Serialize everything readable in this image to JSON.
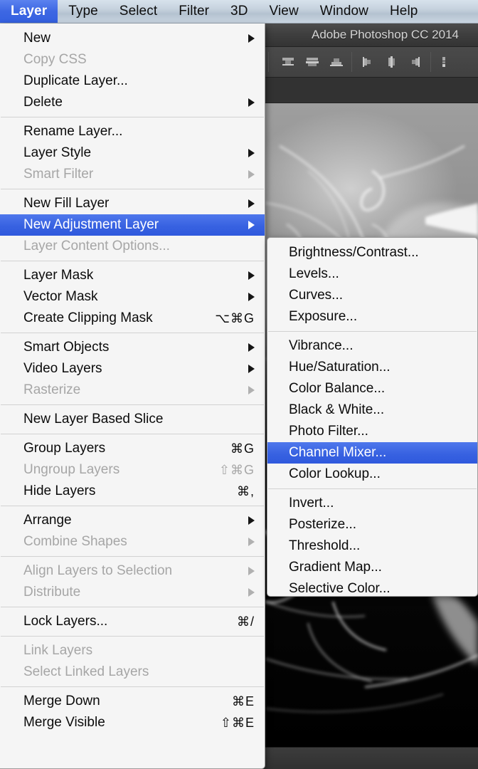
{
  "menubar": {
    "items": [
      {
        "label": "Layer",
        "active": true
      },
      {
        "label": "Type",
        "active": false
      },
      {
        "label": "Select",
        "active": false
      },
      {
        "label": "Filter",
        "active": false
      },
      {
        "label": "3D",
        "active": false
      },
      {
        "label": "View",
        "active": false
      },
      {
        "label": "Window",
        "active": false
      },
      {
        "label": "Help",
        "active": false
      }
    ]
  },
  "application": {
    "title": "Adobe Photoshop CC 2014",
    "align_icons": [
      "align-top-edges-icon",
      "align-vertical-centers-icon",
      "align-bottom-edges-icon",
      "align-left-edges-icon",
      "align-horizontal-centers-icon",
      "align-right-edges-icon",
      "distribute-top-edges-icon"
    ]
  },
  "colors": {
    "accent": "#3862e1",
    "menu_background": "#f5f5f5",
    "menu_text": "#0b0b0b",
    "menu_text_disabled": "#a6a6a6",
    "menubar_text": "#0d0d0d",
    "titlebar_text": "#d6d6d6"
  },
  "layer_menu": {
    "groups": [
      {
        "items": [
          {
            "label": "New",
            "accel": "",
            "arrow": true,
            "disabled": false,
            "selected": false
          },
          {
            "label": "Copy CSS",
            "accel": "",
            "arrow": false,
            "disabled": true,
            "selected": false
          },
          {
            "label": "Duplicate Layer...",
            "accel": "",
            "arrow": false,
            "disabled": false,
            "selected": false
          },
          {
            "label": "Delete",
            "accel": "",
            "arrow": true,
            "disabled": false,
            "selected": false
          }
        ]
      },
      {
        "items": [
          {
            "label": "Rename Layer...",
            "accel": "",
            "arrow": false,
            "disabled": false,
            "selected": false
          },
          {
            "label": "Layer Style",
            "accel": "",
            "arrow": true,
            "disabled": false,
            "selected": false
          },
          {
            "label": "Smart Filter",
            "accel": "",
            "arrow": true,
            "disabled": true,
            "selected": false
          }
        ]
      },
      {
        "items": [
          {
            "label": "New Fill Layer",
            "accel": "",
            "arrow": true,
            "disabled": false,
            "selected": false
          },
          {
            "label": "New Adjustment Layer",
            "accel": "",
            "arrow": true,
            "disabled": false,
            "selected": true
          },
          {
            "label": "Layer Content Options...",
            "accel": "",
            "arrow": false,
            "disabled": true,
            "selected": false
          }
        ]
      },
      {
        "items": [
          {
            "label": "Layer Mask",
            "accel": "",
            "arrow": true,
            "disabled": false,
            "selected": false
          },
          {
            "label": "Vector Mask",
            "accel": "",
            "arrow": true,
            "disabled": false,
            "selected": false
          },
          {
            "label": "Create Clipping Mask",
            "accel": "⌥⌘G",
            "arrow": false,
            "disabled": false,
            "selected": false
          }
        ]
      },
      {
        "items": [
          {
            "label": "Smart Objects",
            "accel": "",
            "arrow": true,
            "disabled": false,
            "selected": false
          },
          {
            "label": "Video Layers",
            "accel": "",
            "arrow": true,
            "disabled": false,
            "selected": false
          },
          {
            "label": "Rasterize",
            "accel": "",
            "arrow": true,
            "disabled": true,
            "selected": false
          }
        ]
      },
      {
        "items": [
          {
            "label": "New Layer Based Slice",
            "accel": "",
            "arrow": false,
            "disabled": false,
            "selected": false
          }
        ]
      },
      {
        "items": [
          {
            "label": "Group Layers",
            "accel": "⌘G",
            "arrow": false,
            "disabled": false,
            "selected": false
          },
          {
            "label": "Ungroup Layers",
            "accel": "⇧⌘G",
            "arrow": false,
            "disabled": true,
            "selected": false
          },
          {
            "label": "Hide Layers",
            "accel": "⌘,",
            "arrow": false,
            "disabled": false,
            "selected": false
          }
        ]
      },
      {
        "items": [
          {
            "label": "Arrange",
            "accel": "",
            "arrow": true,
            "disabled": false,
            "selected": false
          },
          {
            "label": "Combine Shapes",
            "accel": "",
            "arrow": true,
            "disabled": true,
            "selected": false
          }
        ]
      },
      {
        "items": [
          {
            "label": "Align Layers to Selection",
            "accel": "",
            "arrow": true,
            "disabled": true,
            "selected": false
          },
          {
            "label": "Distribute",
            "accel": "",
            "arrow": true,
            "disabled": true,
            "selected": false
          }
        ]
      },
      {
        "items": [
          {
            "label": "Lock Layers...",
            "accel": "⌘/",
            "arrow": false,
            "disabled": false,
            "selected": false
          }
        ]
      },
      {
        "items": [
          {
            "label": "Link Layers",
            "accel": "",
            "arrow": false,
            "disabled": true,
            "selected": false
          },
          {
            "label": "Select Linked Layers",
            "accel": "",
            "arrow": false,
            "disabled": true,
            "selected": false
          }
        ]
      },
      {
        "items": [
          {
            "label": "Merge Down",
            "accel": "⌘E",
            "arrow": false,
            "disabled": false,
            "selected": false
          },
          {
            "label": "Merge Visible",
            "accel": "⇧⌘E",
            "arrow": false,
            "disabled": false,
            "selected": false
          }
        ]
      }
    ]
  },
  "adjustment_submenu": {
    "groups": [
      {
        "items": [
          {
            "label": "Brightness/Contrast...",
            "selected": false
          },
          {
            "label": "Levels...",
            "selected": false
          },
          {
            "label": "Curves...",
            "selected": false
          },
          {
            "label": "Exposure...",
            "selected": false
          }
        ]
      },
      {
        "items": [
          {
            "label": "Vibrance...",
            "selected": false
          },
          {
            "label": "Hue/Saturation...",
            "selected": false
          },
          {
            "label": "Color Balance...",
            "selected": false
          },
          {
            "label": "Black & White...",
            "selected": false
          },
          {
            "label": "Photo Filter...",
            "selected": false
          },
          {
            "label": "Channel Mixer...",
            "selected": true
          },
          {
            "label": "Color Lookup...",
            "selected": false
          }
        ]
      },
      {
        "items": [
          {
            "label": "Invert...",
            "selected": false
          },
          {
            "label": "Posterize...",
            "selected": false
          },
          {
            "label": "Threshold...",
            "selected": false
          },
          {
            "label": "Gradient Map...",
            "selected": false
          },
          {
            "label": "Selective Color...",
            "selected": false
          }
        ]
      }
    ]
  }
}
